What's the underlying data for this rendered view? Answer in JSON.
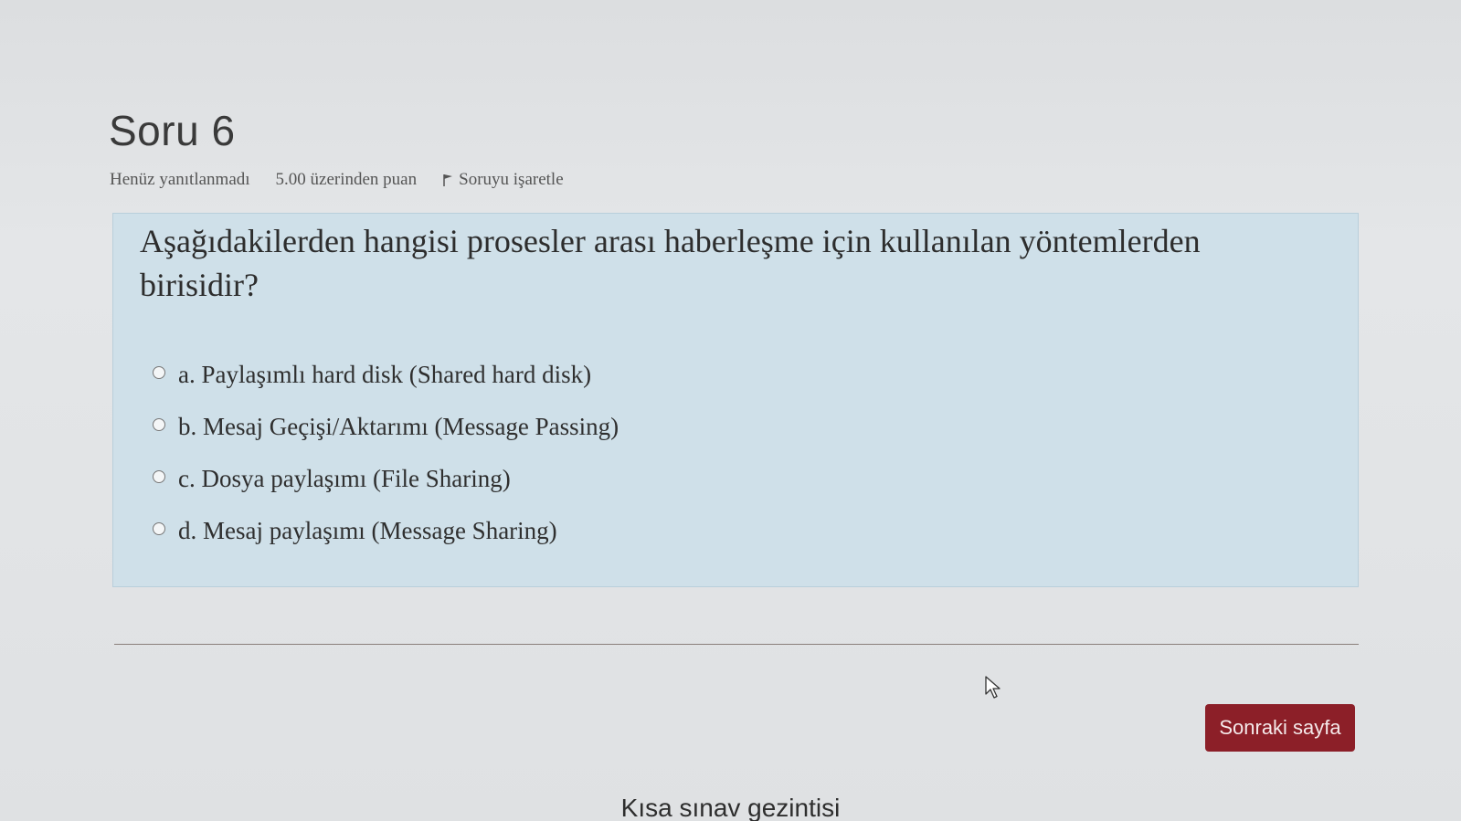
{
  "question": {
    "title": "Soru 6",
    "status": "Henüz yanıtlanmadı",
    "points": "5.00 üzerinden puan",
    "flag_label": "Soruyu işaretle",
    "text": "Aşağıdakilerden hangisi prosesler arası haberleşme için kullanılan yöntemlerden birisidir?",
    "answers": [
      {
        "label": "a. Paylaşımlı hard disk (Shared hard disk)",
        "selected": false
      },
      {
        "label": "b. Mesaj Geçişi/Aktarımı (Message Passing)",
        "selected": false
      },
      {
        "label": "c. Dosya paylaşımı (File Sharing)",
        "selected": false
      },
      {
        "label": "d. Mesaj paylaşımı (Message Sharing)",
        "selected": false
      }
    ]
  },
  "navigation": {
    "next_label": "Sonraki sayfa",
    "quiz_nav_title": "Kısa sınav gezintisi"
  },
  "colors": {
    "primary_button": "#8c1f28",
    "question_background": "#cfe0e9"
  },
  "icons": {
    "flag": "flag-icon",
    "cursor": "mouse-pointer-icon",
    "radio": "radio-unchecked-icon"
  }
}
